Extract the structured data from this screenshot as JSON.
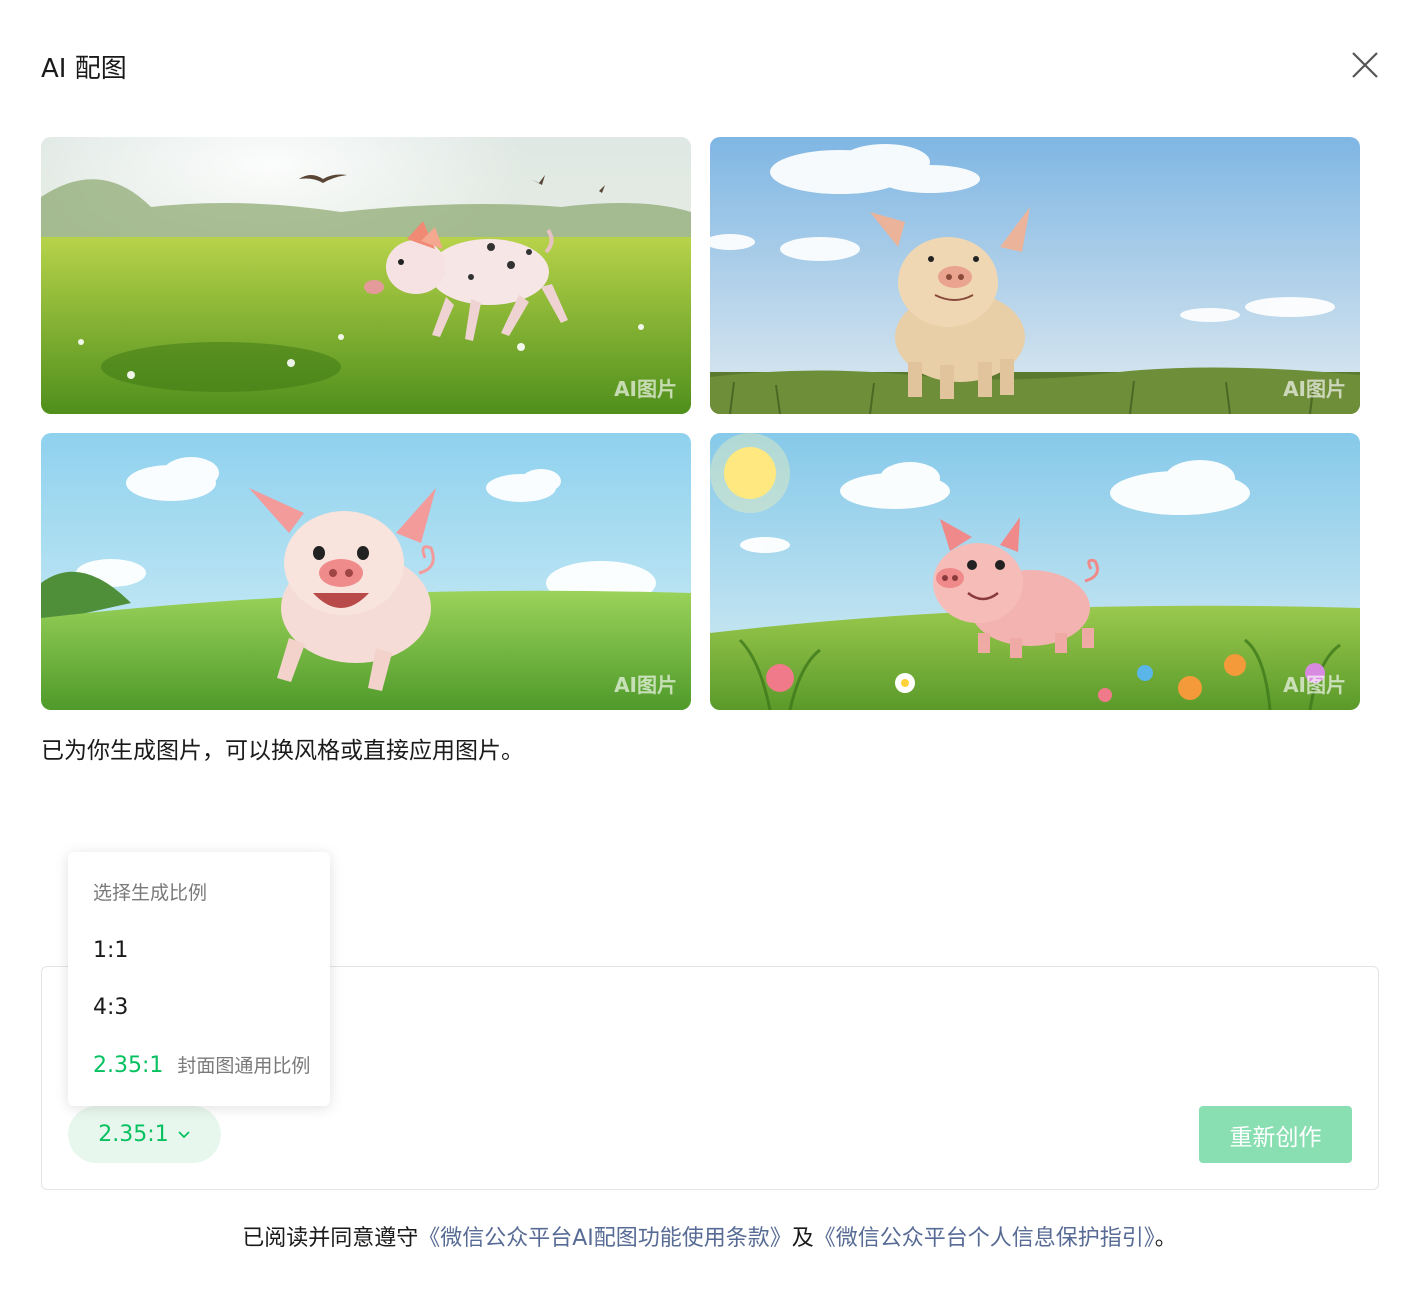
{
  "dialog": {
    "title": "AI 配图",
    "close_icon": "close-icon"
  },
  "images": [
    {
      "watermark": "AI图片",
      "scene": "spotted-piglet-running-meadow"
    },
    {
      "watermark": "AI图片",
      "scene": "piglet-standing-grass-blue-sky"
    },
    {
      "watermark": "AI图片",
      "scene": "happy-cartoon-piglet-running-hills"
    },
    {
      "watermark": "AI图片",
      "scene": "cartoon-piglet-flowers-sun"
    }
  ],
  "result_message": "已为你生成图片，可以换风格或直接应用图片。",
  "ratio_dropdown": {
    "header": "选择生成比例",
    "options": [
      {
        "label": "1:1",
        "hint": ""
      },
      {
        "label": "4:3",
        "hint": ""
      },
      {
        "label": "2.35:1",
        "hint": "封面图通用比例",
        "selected": true
      }
    ]
  },
  "controls": {
    "ratio_value": "2.35:1",
    "recreate_label": "重新创作"
  },
  "agreement": {
    "prefix": "已阅读并同意遵守",
    "link1": "《微信公众平台AI配图功能使用条款》",
    "middle": "及",
    "link2": "《微信公众平台个人信息保护指引》",
    "suffix": "。"
  },
  "colors": {
    "accent": "#07c160",
    "accent_light_bg": "#e8f7ee",
    "button_disabled": "#8adfb2",
    "link": "#576b95"
  }
}
